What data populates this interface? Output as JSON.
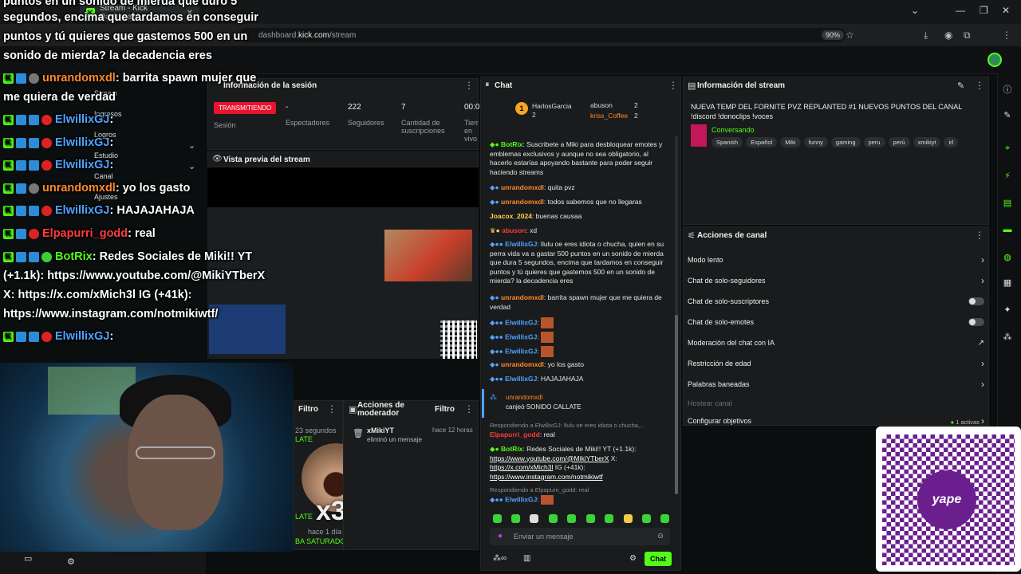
{
  "browser": {
    "tab_title": "Stream - Kick Dashboard",
    "url_prefix": "dashboard.",
    "url_domain": "kick.com",
    "url_path": "/stream",
    "zoom": "90%"
  },
  "sidebar": {
    "items": [
      "Stream",
      "Ingresos",
      "Logros",
      "Estudio",
      "Canal",
      "Ajustes"
    ]
  },
  "session": {
    "title": "Información de la sesión",
    "live_badge": "TRANSMITIENDO",
    "session_label": "Sesión",
    "spectators_value": "-",
    "spectators_label": "Espectadores",
    "followers_value": "222",
    "followers_label": "Seguidores",
    "subs_value": "7",
    "subs_label": "Cantidad de suscripciones",
    "time_value": "00:0",
    "time_label": "Tiempo en vivo"
  },
  "preview": {
    "title": "Vista previa del stream"
  },
  "bottom_left_panel": {
    "filter_label": "Filtro",
    "snippet1": "23 segundos",
    "snippet2": "LATE",
    "snippet3": "LATE",
    "snippet4": "hace 1 día",
    "snippet5": "BA SATURADO"
  },
  "mod_actions": {
    "title": "Acciones de moderador",
    "filter_label": "Filtro",
    "entry_user": "xMikiYT",
    "entry_action": "eliminó un mensaje",
    "entry_time": "hace 12 horas"
  },
  "overlay": {
    "lines": [
      {
        "text": "puntos en un sonido de mierda que duró 5"
      },
      {
        "text": "segundos, encima que tardamos en conseguir"
      },
      {
        "text": "puntos y tú quieres que gastemos 500 en un"
      },
      {
        "text": "sonido de mierda? la decadencia eres"
      }
    ],
    "msgs": [
      {
        "user": "unrandomxdl",
        "color": "#ff8a2b",
        "text": ": barrita spawn mujer que"
      },
      {
        "user": "",
        "color": "#fff",
        "text": "me quiera de verdad"
      },
      {
        "user": "ElwillixGJ",
        "color": "#4fa3ff",
        "text": ":"
      },
      {
        "user": "ElwillixGJ",
        "color": "#4fa3ff",
        "text": ":"
      },
      {
        "user": "ElwillixGJ",
        "color": "#4fa3ff",
        "text": ":"
      },
      {
        "user": "unrandomxdl",
        "color": "#ff8a2b",
        "text": ": yo los gasto"
      },
      {
        "user": "ElwillixGJ",
        "color": "#4fa3ff",
        "text": ": HAJAJAHAJA"
      },
      {
        "user": "Elpapurri_godd",
        "color": "#ff3b3b",
        "text": ": real"
      },
      {
        "user": "BotRix",
        "color": "#53fc18",
        "text": ": Redes Sociales de Miki!! YT"
      },
      {
        "user": "",
        "color": "#fff",
        "text": "(+1.1k): https://www.youtube.com/@MikiYTberX"
      },
      {
        "user": "",
        "color": "#fff",
        "text": "X: https://x.com/xMich3l IG (+41k):"
      },
      {
        "user": "",
        "color": "#fff",
        "text": "https://www.instagram.com/notmikiwtf/"
      },
      {
        "user": "ElwillixGJ",
        "color": "#4fa3ff",
        "text": ":"
      }
    ]
  },
  "chat": {
    "title": "Chat",
    "top_gifter_1": "HarlosGarcia",
    "top_gifter_1_count": "2",
    "top_gifter_2": "abuson",
    "top_gifter_2_count": "2",
    "top_gifter_3": "kriss_Coffee",
    "top_gifter_3_count": "2",
    "rank": "1",
    "messages": [
      {
        "user": "BotRix",
        "ucolor": "#53fc18",
        "text": ": Suscribete a Miki para desbloquear emotes y emblemas exclusivos y aunque no sea obligatorio, al hacerlo estarías apoyando bastante para poder seguir haciendo streams"
      },
      {
        "user": "unrandomxdl",
        "ucolor": "#ff8a2b",
        "text": ": quita pvz"
      },
      {
        "user": "unrandomxdl",
        "ucolor": "#ff8a2b",
        "text": ": todos sabemos que no llegaras"
      },
      {
        "user": "Joacox_2024",
        "ucolor": "#ffd54a",
        "text": ": buenas causaa"
      },
      {
        "user": "abuson",
        "ucolor": "#ff3b3b",
        "text": ": xd"
      },
      {
        "user": "ElwillixGJ",
        "ucolor": "#4fa3ff",
        "text": ": llulu oe eres idiota o chucha, quien en su perra vida va a gastar 500 puntos en un sonido de mierda que dura 5 segundos, encima que tardamos en conseguir puntos y tú quieres que gastemos 500 en un sonido de mierda? la decadencia eres"
      },
      {
        "user": "unrandomxdl",
        "ucolor": "#ff8a2b",
        "text": ": barrita spawn mujer que me quiera de verdad"
      },
      {
        "user": "ElwillixGJ",
        "ucolor": "#4fa3ff",
        "text": ":"
      },
      {
        "user": "ElwillixGJ",
        "ucolor": "#4fa3ff",
        "text": ":"
      },
      {
        "user": "ElwillixGJ",
        "ucolor": "#4fa3ff",
        "text": ":"
      },
      {
        "user": "unrandomxdl",
        "ucolor": "#ff8a2b",
        "text": ": yo los gasto"
      },
      {
        "user": "ElwillixGJ",
        "ucolor": "#4fa3ff",
        "text": ": HAJAJAHAJA"
      }
    ],
    "redeem_user": "unrandomxdl",
    "redeem_text": "canjeó SONIDO CALLATE",
    "reply1_note": "Respondiendo a ElwillixGJ: llulu oe eres idiota o chucha,...",
    "reply1_user": "Elpapurri_godd",
    "reply1_text": ": real",
    "botrix_user": "BotRix",
    "botrix_text_pre": ": Redes Sociales de Miki!! YT (+1.1k): ",
    "botrix_link1": "https://www.youtube.com/@MikiYTberX",
    "botrix_text_mid": " X: ",
    "botrix_link2": "https://x.com/xMich3l",
    "botrix_text_mid2": " IG (+41k): ",
    "botrix_link3": "https://www.instagram.com/notmikiwtf",
    "reply2_note": "Respondiendo a Elpapurri_godd: real",
    "reply2_user": "ElwillixGJ",
    "reply2_text": ":",
    "input_placeholder": "Enviar un mensaje",
    "send_label": "Chat"
  },
  "stream_info": {
    "title": "Información del stream",
    "stream_title": "NUEVA TEMP DEL FORNITE PVZ REPLANTED #1 NUEVOS PUNTOS DEL CANAL !discord !donoclips !voces",
    "category": "Conversando",
    "tags": [
      "Spanish",
      "Español",
      "Miki",
      "funny",
      "gaming",
      "peru",
      "perú",
      "xmikiyt",
      "irl"
    ]
  },
  "channel_actions": {
    "title": "Acciones de canal",
    "rows": [
      {
        "label": "Modo lento",
        "control": "chevron"
      },
      {
        "label": "Chat de solo-seguidores",
        "control": "chevron"
      },
      {
        "label": "Chat de solo-suscriptores",
        "control": "toggle"
      },
      {
        "label": "Chat de solo-emotes",
        "control": "toggle"
      },
      {
        "label": "Moderación del chat con IA",
        "control": "external"
      },
      {
        "label": "Restricción de edad",
        "control": "chevron"
      },
      {
        "label": "Palabras baneadas",
        "control": "chevron"
      },
      {
        "label": "Hostear canal",
        "control": "none"
      },
      {
        "label": "Configurar objetivos",
        "control": "chevron"
      }
    ],
    "goals_active": "1 activas"
  },
  "qr": {
    "brand": "yape"
  },
  "emote_overlay": {
    "multiplier": "x3"
  },
  "colors": {
    "brand": "#53fc18",
    "live": "#e8142e",
    "panel": "#191b1c",
    "yape": "#6b1f8f"
  }
}
